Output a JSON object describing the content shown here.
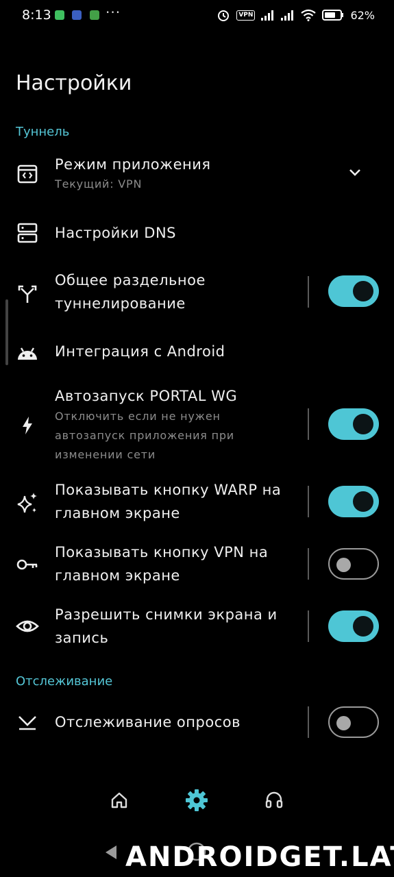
{
  "status_bar": {
    "time": "8:13",
    "dots": "···",
    "vpn_badge": "VPN",
    "battery": "62%"
  },
  "page": {
    "title": "Настройки"
  },
  "sections": {
    "tunnel": "Туннель",
    "tracking": "Отслеживание"
  },
  "items": [
    {
      "title": "Режим приложения",
      "subtitle": "Текущий: VPN",
      "icon": "app-mode-icon",
      "control": "dropdown"
    },
    {
      "title": "Настройки DNS",
      "icon": "dns-icon"
    },
    {
      "title": "Общее раздельное туннелирование",
      "icon": "split-icon",
      "control": "toggle",
      "on": true
    },
    {
      "title": "Интеграция с Android",
      "icon": "android-icon"
    },
    {
      "title": "Автозапуск PORTAL WG",
      "subtitle": "Отключить если не нужен автозапуск приложения при изменении сети",
      "icon": "bolt-icon",
      "control": "toggle",
      "on": true
    },
    {
      "title": "Показывать кнопку WARP на главном экране",
      "icon": "sparkle-icon",
      "control": "toggle",
      "on": true
    },
    {
      "title": "Показывать кнопку VPN на главном экране",
      "icon": "key-icon",
      "control": "toggle",
      "on": false
    },
    {
      "title": "Разрешить снимки экрана и запись",
      "icon": "eye-icon",
      "control": "toggle",
      "on": true
    },
    {
      "title": "Отслеживание опросов",
      "icon": "poll-tracking-icon",
      "control": "toggle",
      "on": false
    }
  ],
  "bottom_nav": [
    "home-icon",
    "settings-icon",
    "headset-icon"
  ],
  "colors": {
    "accent": "#4ec6d5",
    "background": "#000000"
  },
  "watermark": "ANDROIDGET.LAT"
}
